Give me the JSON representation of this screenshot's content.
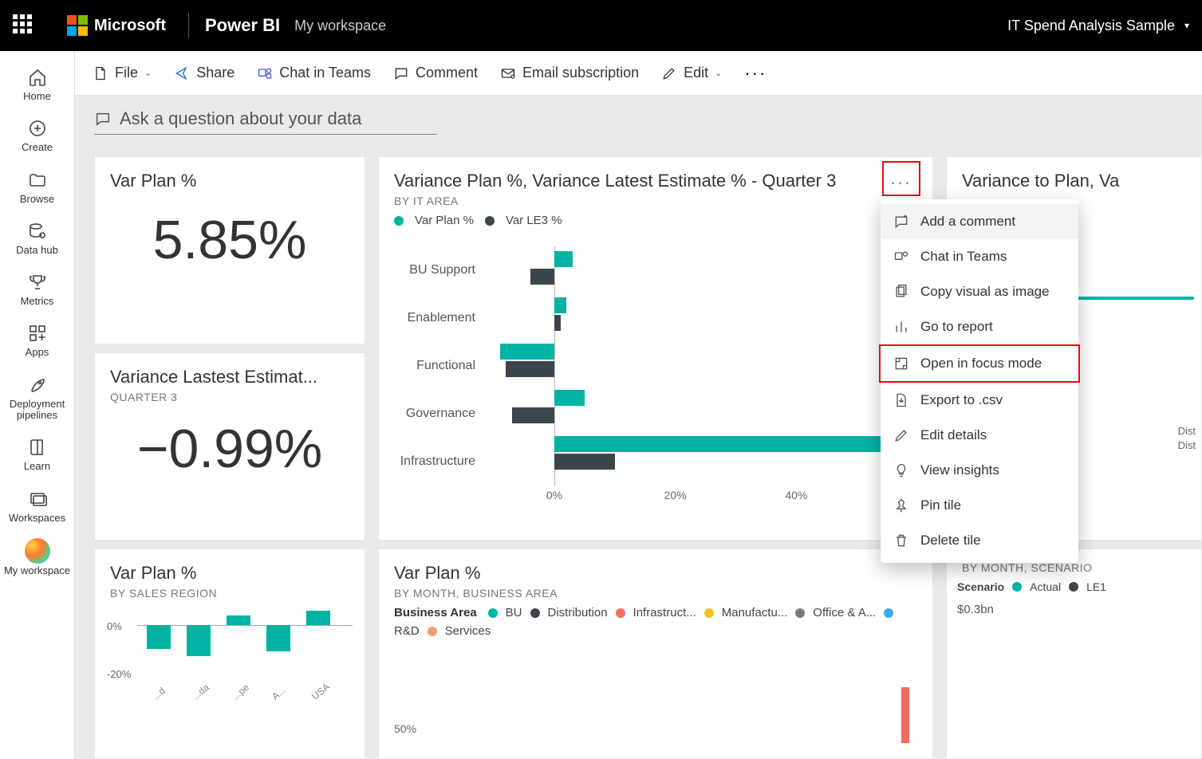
{
  "topbar": {
    "brand": "Microsoft",
    "product": "Power BI",
    "workspace": "My workspace",
    "report_name": "IT Spend Analysis Sample"
  },
  "leftrail": {
    "home": "Home",
    "create": "Create",
    "browse": "Browse",
    "datahub": "Data hub",
    "metrics": "Metrics",
    "apps": "Apps",
    "pipelines": "Deployment pipelines",
    "learn": "Learn",
    "workspaces": "Workspaces",
    "my_workspace": "My workspace"
  },
  "cmdbar": {
    "file": "File",
    "share": "Share",
    "chat_teams": "Chat in Teams",
    "comment": "Comment",
    "email_sub": "Email subscription",
    "edit": "Edit"
  },
  "qna_placeholder": "Ask a question about your data",
  "tile1": {
    "title": "Var Plan %",
    "value": "5.85%"
  },
  "tile2": {
    "title": "Variance Lastest Estimat...",
    "subtitle": "QUARTER 3",
    "value": "−0.99%"
  },
  "tile3": {
    "title": "Variance Plan %, Variance Latest Estimate % - Quarter 3",
    "subtitle": "BY IT AREA",
    "legend": {
      "a": "Var Plan %",
      "b": "Var LE3 %"
    },
    "xticks": [
      "0%",
      "20%",
      "40%"
    ]
  },
  "chart_data": {
    "type": "bar",
    "title": "Variance Plan %, Variance Latest Estimate % - Quarter 3",
    "subtitle": "BY IT AREA",
    "orientation": "horizontal",
    "xlabel": "",
    "ylabel": "",
    "x_ticks": [
      0,
      20,
      40
    ],
    "categories": [
      "BU Support",
      "Enablement",
      "Functional",
      "Governance",
      "Infrastructure"
    ],
    "series": [
      {
        "name": "Var Plan %",
        "color": "#00b3a4",
        "values": [
          3,
          2,
          -9,
          5,
          55
        ]
      },
      {
        "name": "Var LE3 %",
        "color": "#3a464c",
        "values": [
          -4,
          1,
          -8,
          -7,
          10
        ]
      }
    ]
  },
  "tile4": {
    "title": "Var Plan %",
    "subtitle": "BY SALES REGION",
    "yticks": [
      "0%",
      "-20%"
    ],
    "xlabels": [
      "...d",
      "...da",
      "...pe",
      "A...",
      "USA"
    ],
    "values": [
      -10,
      -13,
      4,
      -11,
      6
    ]
  },
  "tile5": {
    "title": "Var Plan %",
    "subtitle": "BY MONTH, BUSINESS AREA",
    "legend_title": "Business Area",
    "legend_items": [
      {
        "label": "BU",
        "color": "#00b3a4"
      },
      {
        "label": "Distribution",
        "color": "#3a464c"
      },
      {
        "label": "Infrastruct...",
        "color": "#f26d5b"
      },
      {
        "label": "Manufactu...",
        "color": "#f5c518"
      },
      {
        "label": "Office & A...",
        "color": "#6e7b82"
      },
      {
        "label": "R&D",
        "color": "#3fa9f5"
      },
      {
        "label": "Services",
        "color": "#f59b6d"
      }
    ],
    "ytick": "50%"
  },
  "tile6": {
    "title": "Variance to Plan, Va",
    "value_label": "%",
    "legend_lines": [
      "Dist",
      "Dist"
    ]
  },
  "tile7": {
    "subtitle": "BY MONTH, SCENARIO",
    "legend_title": "Scenario",
    "legend_items": [
      {
        "label": "Actual",
        "color": "#00b3a4"
      },
      {
        "label": "LE1",
        "color": "#3a464c"
      }
    ],
    "value": "$0.3bn"
  },
  "context_menu": {
    "add_comment": "Add a comment",
    "chat_teams": "Chat in Teams",
    "copy_image": "Copy visual as image",
    "go_report": "Go to report",
    "focus_mode": "Open in focus mode",
    "export_csv": "Export to .csv",
    "edit_details": "Edit details",
    "view_insights": "View insights",
    "pin_tile": "Pin tile",
    "delete_tile": "Delete tile"
  }
}
